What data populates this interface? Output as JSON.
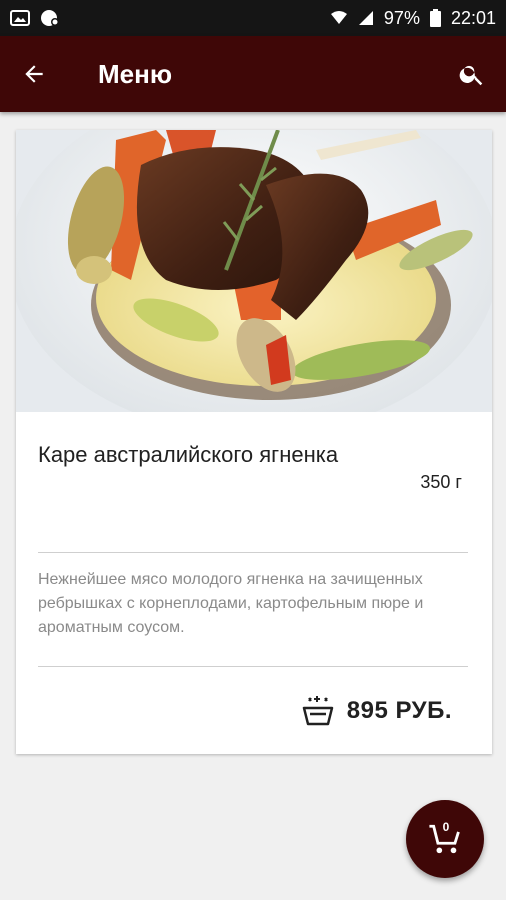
{
  "status_bar": {
    "battery": "97%",
    "time": "22:01"
  },
  "app_bar": {
    "title": "Меню",
    "icons": [
      "back-arrow-icon",
      "search-icon"
    ]
  },
  "dish": {
    "name": "Каре австралийского ягненка",
    "weight": "350 г",
    "description": "Нежнейшее мясо молодого ягненка на зачищенных ребрышках с корнеплодами, картофельным пюре и ароматным соусом.",
    "price": "895 РУБ."
  },
  "cart": {
    "count": "0",
    "icon": "cart-icon"
  },
  "colors": {
    "primary": "#3f0707",
    "status_bar": "#151515",
    "background": "#f0f0f0"
  }
}
